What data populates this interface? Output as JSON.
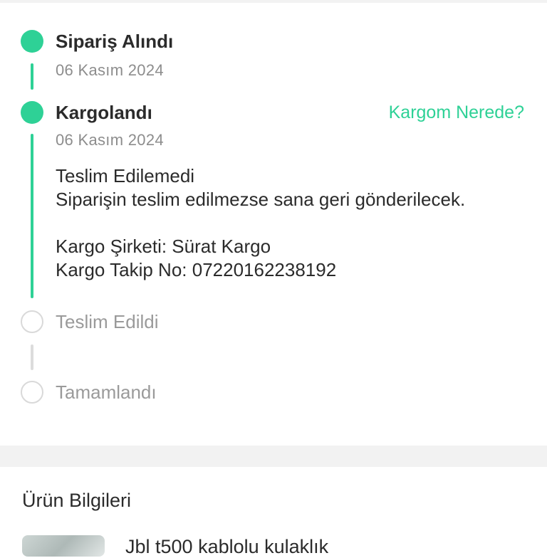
{
  "colors": {
    "accent": "#2ed196",
    "pending": "#d9d9d9",
    "muted_text": "#8d8d8d",
    "section_bg": "#f2f2f2"
  },
  "timeline": {
    "steps": [
      {
        "title": "Sipariş Alındı",
        "date": "06 Kasım 2024",
        "status": "done",
        "icon": "check-dot-icon"
      },
      {
        "title": "Kargolandı",
        "date": "06 Kasım 2024",
        "status": "done",
        "icon": "check-dot-icon"
      },
      {
        "title": "Teslim Edildi",
        "status": "pending",
        "icon": "empty-circle-icon"
      },
      {
        "title": "Tamamlandı",
        "status": "pending",
        "icon": "empty-circle-icon"
      }
    ],
    "track_link": "Kargom Nerede?",
    "shipment": {
      "status_title": "Teslim Edilemedi",
      "status_message": "Siparişin teslim edilmezse sana geri gönderilecek.",
      "carrier": "Kargo Şirketi: Sürat Kargo",
      "tracking_no": "Kargo Takip No: 07220162238192"
    }
  },
  "product_section": {
    "title": "Ürün Bilgileri",
    "product_name": "Jbl t500 kablolu kulaklık"
  }
}
